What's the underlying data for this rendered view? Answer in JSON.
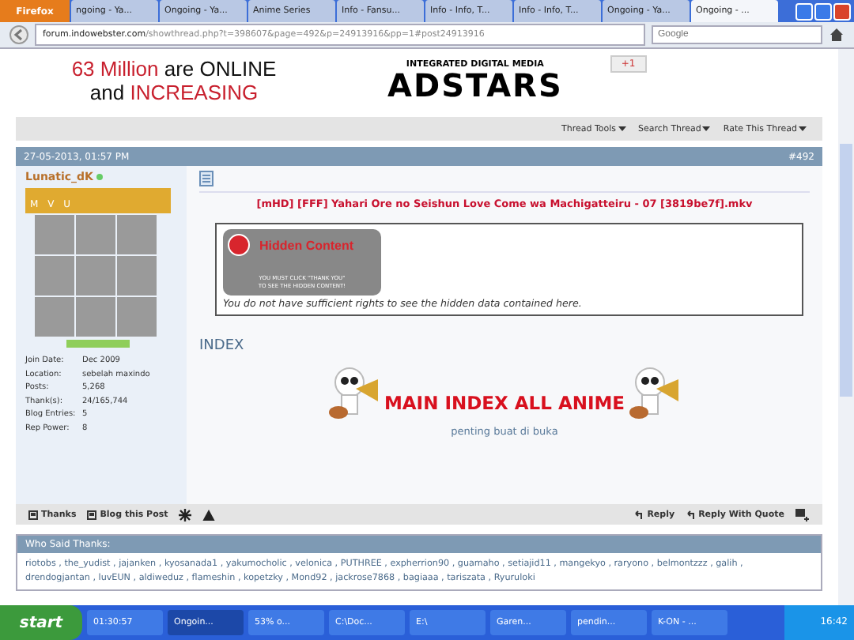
{
  "browser": {
    "menu_button": "Firefox",
    "tabs": [
      {
        "label": "ngoing - Ya...",
        "selected": false
      },
      {
        "label": "Ongoing - Ya...",
        "selected": false
      },
      {
        "label": "Anime Series",
        "selected": false
      },
      {
        "label": "Info - Fansu...",
        "selected": false
      },
      {
        "label": "Info - Info, T...",
        "selected": false
      },
      {
        "label": "Info - Info, T...",
        "selected": false
      },
      {
        "label": "Ongoing - Ya...",
        "selected": false
      },
      {
        "label": "Ongoing - ...",
        "selected": true
      }
    ],
    "url_domain": "forum.indowebster.com",
    "url_path": "/showthread.php?t=398607&page=492&p=24913916&pp=1#post24913916",
    "search_placeholder": "Google"
  },
  "ad": {
    "line_1_red": "63 Million",
    "line_1_rest": "are ONLINE",
    "line_2_start": "and",
    "line_2_red": "INCREASING",
    "brand_tagline": "INTEGRATED DIGITAL MEDIA",
    "brand": "ADSTARS",
    "plus_one": "+1"
  },
  "thread_tools": [
    "Thread Tools",
    "Search Thread",
    "Rate This Thread"
  ],
  "post": {
    "date": "27-05-2013, 01:57 PM",
    "number": "#492",
    "user": {
      "name": "Lunatic_dK",
      "online": true,
      "rank": "M V U",
      "stats": [
        {
          "label": "Join Date:",
          "value": "Dec 2009"
        },
        {
          "label": "Location:",
          "value": "sebelah maxindo"
        },
        {
          "label": "Posts:",
          "value": "5,268"
        },
        {
          "label": "Thank(s):",
          "value": "24/165,744"
        },
        {
          "label": "Blog Entries:",
          "value": "5"
        },
        {
          "label": "Rep Power:",
          "value": "8"
        }
      ]
    },
    "title": "[mHD] [FFF] Yahari Ore no Seishun Love Come wa Machigatteiru - 07 [3819be7f].mkv",
    "hidden": {
      "heading": "Hidden Content",
      "note_1": "YOU MUST CLICK \"THANK YOU\"",
      "note_2": "TO SEE THE HIDDEN CONTENT!",
      "message": "You do not have sufficient rights to see the hidden data contained here."
    },
    "index_label": "INDEX",
    "banner": "MAIN INDEX ALL ANIME",
    "banner_caption": "penting buat di buka",
    "footer_left": [
      "Thanks",
      "Blog this Post"
    ],
    "footer_right": [
      "Reply",
      "Reply With Quote"
    ]
  },
  "thanks": {
    "heading": "Who Said Thanks:",
    "lines": [
      "riotobs , the_yudist , jajanken , kyosanada1 , yakumocholic , velonica , PUTHREE , expherrion90 , guamaho , setiajid11 , mangekyo , raryono , belmontzzz , galih ,",
      "drendogjantan , luvEUN , aldiweduz , flameshin , kopetzky , Mond92 , jackrose7868 , bagiaaa , tariszata , Ryuruloki"
    ]
  },
  "taskbar": {
    "start": "start",
    "items": [
      {
        "label": "01:30:57",
        "selected": false
      },
      {
        "label": "Ongoin...",
        "selected": true
      },
      {
        "label": "53% o...",
        "selected": false
      },
      {
        "label": "C:\\Doc...",
        "selected": false
      },
      {
        "label": "E:\\",
        "selected": false
      },
      {
        "label": "Garen...",
        "selected": false
      },
      {
        "label": "pendin...",
        "selected": false
      },
      {
        "label": "K-ON - ...",
        "selected": false
      }
    ],
    "clock": "16:42"
  }
}
